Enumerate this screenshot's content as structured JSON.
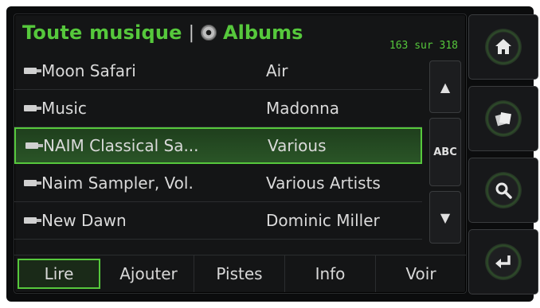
{
  "header": {
    "title": "Toute musique",
    "separator": "|",
    "section": "Albums",
    "counter": "163 sur 318"
  },
  "albums": [
    {
      "album": "Moon Safari",
      "artist": "Air"
    },
    {
      "album": "Music",
      "artist": "Madonna"
    },
    {
      "album": "NAIM Classical Sa...",
      "artist": "Various"
    },
    {
      "album": "Naim Sampler, Vol.",
      "artist": "Various Artists"
    },
    {
      "album": "New Dawn",
      "artist": "Dominic Miller"
    }
  ],
  "selected_index": 2,
  "scroll": {
    "up": "▲",
    "index": "ABC",
    "down": "▼"
  },
  "tabs": [
    {
      "label": "Lire"
    },
    {
      "label": "Ajouter"
    },
    {
      "label": "Pistes"
    },
    {
      "label": "Info"
    },
    {
      "label": "Voir"
    }
  ],
  "side_buttons": [
    {
      "icon": "home-icon"
    },
    {
      "icon": "albums-icon"
    },
    {
      "icon": "search-icon"
    },
    {
      "icon": "enter-icon"
    }
  ],
  "colors": {
    "accent": "#56c83c",
    "text": "#dadada",
    "background": "#141516"
  }
}
